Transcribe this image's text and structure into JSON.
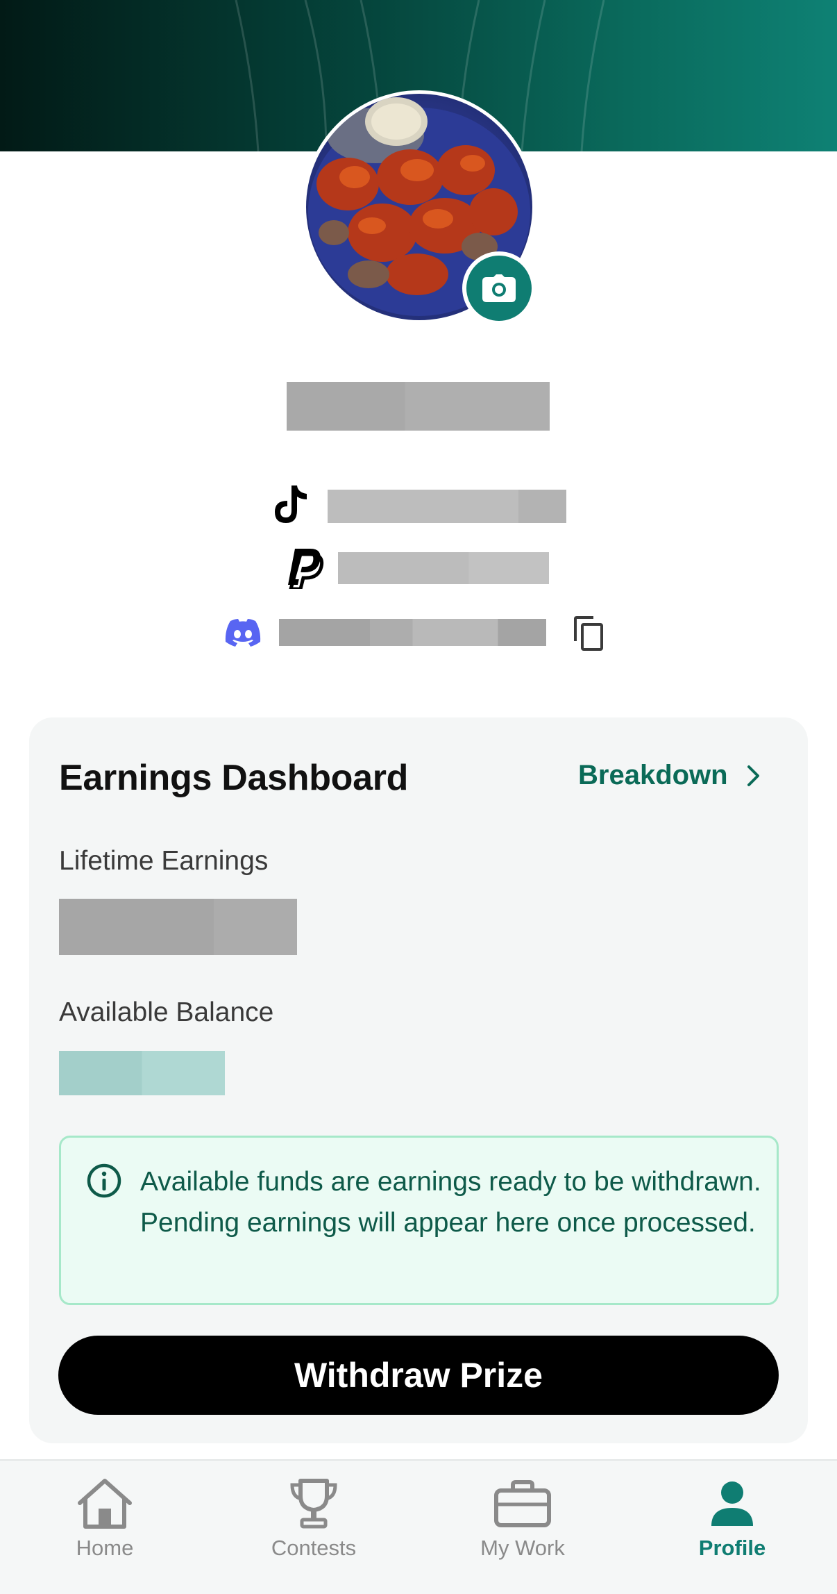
{
  "header": {
    "banner": "decorative-banner"
  },
  "profile": {
    "avatar_alt": "profile photo",
    "camera_icon": "camera-icon"
  },
  "socials": [
    {
      "icon": "tiktok-icon"
    },
    {
      "icon": "paypal-icon"
    },
    {
      "icon": "discord-icon",
      "copy_icon": "copy-icon"
    }
  ],
  "earnings": {
    "title": "Earnings Dashboard",
    "breakdown_label": "Breakdown",
    "lifetime_label": "Lifetime Earnings",
    "balance_label": "Available Balance",
    "info_text": "Available funds are earnings ready to be withdrawn. Pending earnings will appear here once processed.",
    "withdraw_label": "Withdraw Prize"
  },
  "nav": {
    "items": [
      {
        "label": "Home",
        "icon": "home-icon",
        "active": false
      },
      {
        "label": "Contests",
        "icon": "trophy-icon",
        "active": false
      },
      {
        "label": "My Work",
        "icon": "briefcase-icon",
        "active": false
      },
      {
        "label": "Profile",
        "icon": "person-icon",
        "active": true
      }
    ]
  },
  "colors": {
    "accent": "#0f7d72",
    "breakdown_green": "#0a6a57",
    "info_bg": "#ebfbf4",
    "info_border": "#a6e8c9",
    "discord": "#5865f2"
  }
}
